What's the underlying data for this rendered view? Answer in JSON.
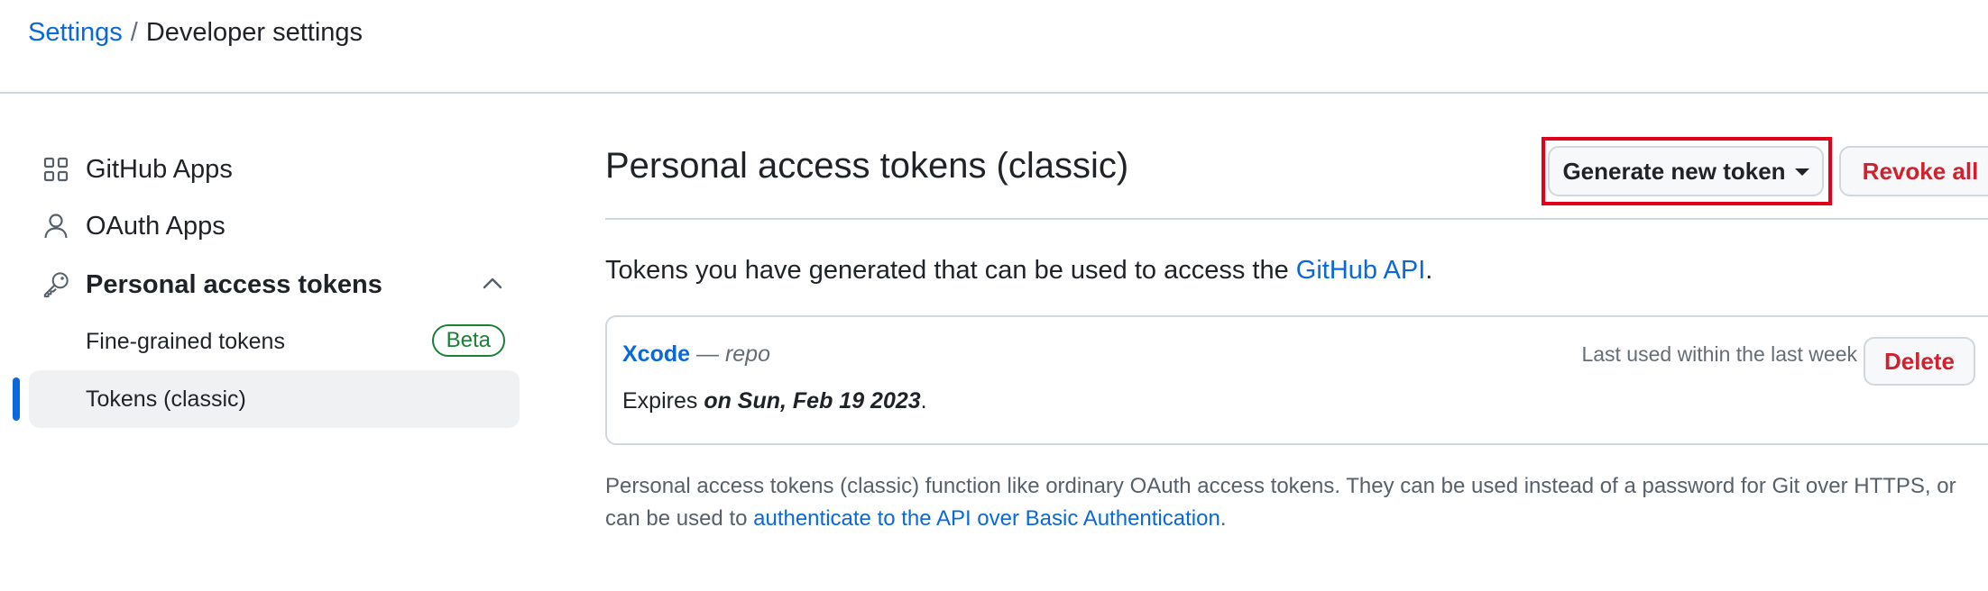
{
  "breadcrumb": {
    "parent": "Settings",
    "separator": "/",
    "current": "Developer settings"
  },
  "sidebar": {
    "items": [
      {
        "label": "GitHub Apps",
        "icon": "apps-grid-icon"
      },
      {
        "label": "OAuth Apps",
        "icon": "person-icon"
      },
      {
        "label": "Personal access tokens",
        "icon": "key-icon",
        "expanded": true
      }
    ],
    "subitems": [
      {
        "label": "Fine-grained tokens",
        "badge": "Beta"
      },
      {
        "label": "Tokens (classic)",
        "selected": true
      }
    ]
  },
  "main": {
    "title": "Personal access tokens (classic)",
    "generate_button": "Generate new token",
    "revoke_button": "Revoke all",
    "intro_text": "Tokens you have generated that can be used to access the ",
    "intro_link": "GitHub API",
    "intro_end": ".",
    "token": {
      "name": "Xcode",
      "dash": " — ",
      "scope": "repo",
      "last_used": "Last used within the last week",
      "delete_button": "Delete",
      "expires_prefix": "Expires ",
      "expires_date": "on Sun, Feb 19 2023",
      "expires_suffix": "."
    },
    "footer": {
      "text_before": "Personal access tokens (classic) function like ordinary OAuth access tokens. They can be used instead of a password for Git over HTTPS, or can be used to ",
      "link": "authenticate to the API over Basic Authentication",
      "text_after": "."
    }
  },
  "colors": {
    "link": "#0969da",
    "danger": "#cf222e",
    "success": "#1a7f37",
    "highlight": "#e0001b"
  }
}
